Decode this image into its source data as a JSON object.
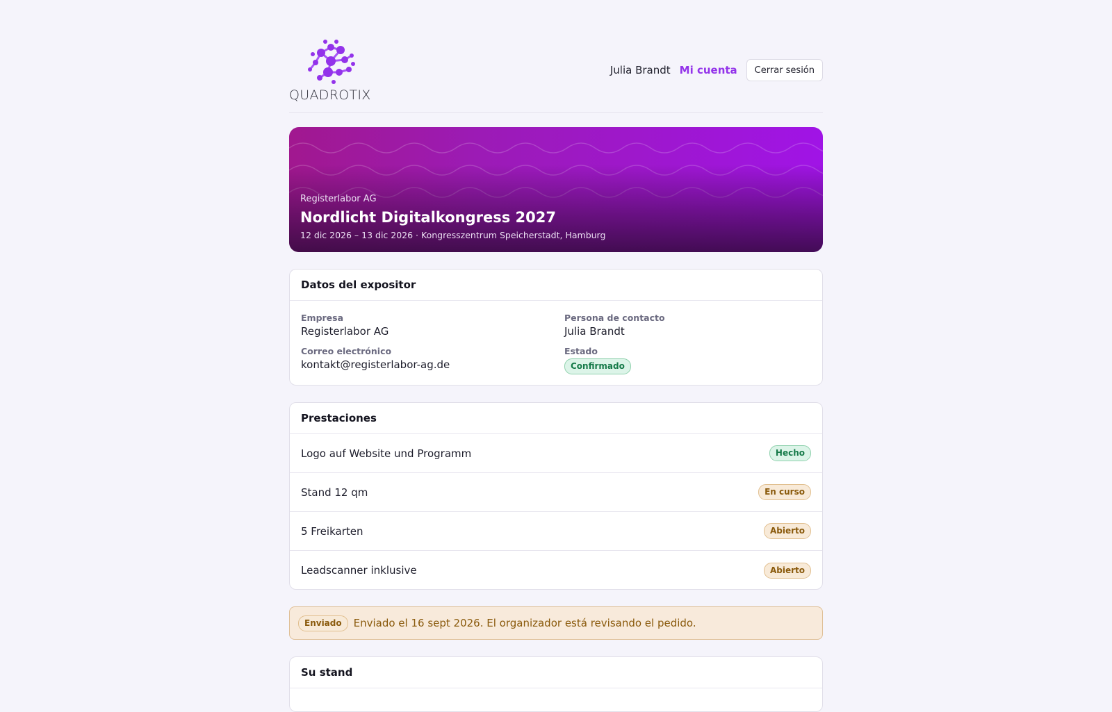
{
  "header": {
    "logo_text": "QUADROTIX",
    "user_name": "Julia Brandt",
    "account_link": "Mi cuenta",
    "logout_label": "Cerrar sesión"
  },
  "event": {
    "organizer": "Registerlabor AG",
    "title": "Nordlicht Digitalkongress 2027",
    "meta": "12 dic 2026 – 13 dic 2026 · Kongresszentrum Speicherstadt, Hamburg"
  },
  "exhibitor": {
    "heading": "Datos del expositor",
    "company_label": "Empresa",
    "company_value": "Registerlabor AG",
    "contact_label": "Persona de contacto",
    "contact_value": "Julia Brandt",
    "email_label": "Correo electrónico",
    "email_value": "kontakt@registerlabor-ag.de",
    "status_label": "Estado",
    "status_value": "Confirmado"
  },
  "services": {
    "heading": "Prestaciones",
    "items": [
      {
        "label": "Logo auf Website und Programm",
        "status": "Hecho"
      },
      {
        "label": "Stand 12 qm",
        "status": "En curso"
      },
      {
        "label": "5 Freikarten",
        "status": "Abierto"
      },
      {
        "label": "Leadscanner inklusive",
        "status": "Abierto"
      }
    ]
  },
  "notice": {
    "badge": "Enviado",
    "text": "Enviado el 16 sept 2026. El organizador está revisando el pedido."
  },
  "stand": {
    "heading": "Su stand"
  },
  "colors": {
    "accent": "#9333ea",
    "success": "#167a49",
    "warning": "#8a5a0c",
    "page_bg": "#f5f4fb"
  }
}
